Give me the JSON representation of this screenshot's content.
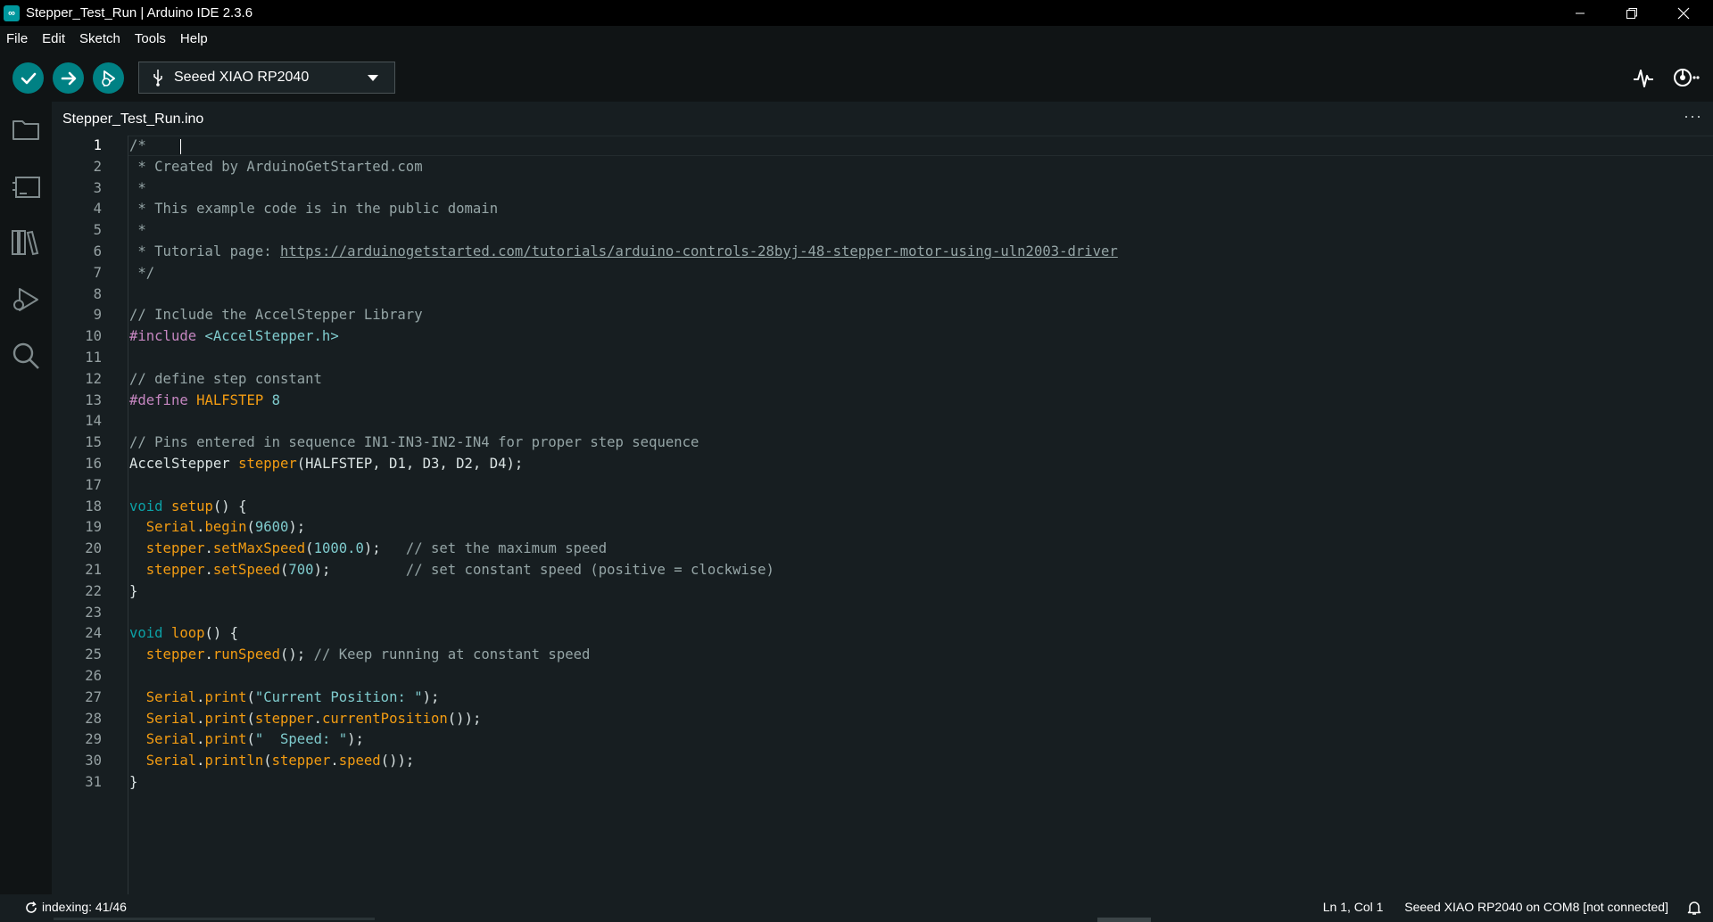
{
  "window": {
    "title": "Stepper_Test_Run | Arduino IDE 2.3.6",
    "logo_text": "∞"
  },
  "menu": [
    "File",
    "Edit",
    "Sketch",
    "Tools",
    "Help"
  ],
  "toolbar": {
    "board": "Seeed XIAO RP2040",
    "icons": [
      "verify-icon",
      "upload-icon",
      "debug-icon",
      "usb-icon",
      "chevron-down-icon",
      "serial-plotter-icon",
      "serial-monitor-icon"
    ]
  },
  "sidebar": {
    "icons": [
      "folder-icon",
      "boards-manager-icon",
      "library-manager-icon",
      "debug-icon",
      "search-icon"
    ]
  },
  "tab": {
    "label": "Stepper_Test_Run.ino",
    "more": "···"
  },
  "code": {
    "line_numbers": [
      "1",
      "2",
      "3",
      "4",
      "5",
      "6",
      "7",
      "8",
      "9",
      "10",
      "11",
      "12",
      "13",
      "14",
      "15",
      "16",
      "17",
      "18",
      "19",
      "20",
      "21",
      "22",
      "23",
      "24",
      "25",
      "26",
      "27",
      "28",
      "29",
      "30",
      "31"
    ],
    "l1": "/*",
    "l2": " * Created by ArduinoGetStarted.com",
    "l3": " *",
    "l4": " * This example code is in the public domain",
    "l5": " *",
    "l6_pre": " * Tutorial page: ",
    "l6_link": "https://arduinogetstarted.com/tutorials/arduino-controls-28byj-48-stepper-motor-using-uln2003-driver",
    "l7": " */",
    "l9": "// Include the AccelStepper Library",
    "l10_pp": "#include",
    "l10_inc": "<AccelStepper.h>",
    "l12": "// define step constant",
    "l13_pp": "#define",
    "l13_mac": "HALFSTEP",
    "l13_num": "8",
    "l15": "// Pins entered in sequence IN1-IN3-IN2-IN4 for proper step sequence",
    "l16_type": "AccelStepper",
    "l16_fn": "stepper",
    "l16_rest": "(HALFSTEP, D1, D3, D2, D4);",
    "l18_kw": "void",
    "l18_fn": "setup",
    "l18_rest": "() {",
    "l19_obj": "Serial",
    "l19_fn": "begin",
    "l19_num": "9600",
    "l20_obj": "stepper",
    "l20_fn": "setMaxSpeed",
    "l20_num": "1000.0",
    "l20_c": "// set the maximum speed",
    "l21_obj": "stepper",
    "l21_fn": "setSpeed",
    "l21_num": "700",
    "l21_c": "// set constant speed (positive = clockwise)",
    "l22": "}",
    "l24_kw": "void",
    "l24_fn": "loop",
    "l24_rest": "() {",
    "l25_obj": "stepper",
    "l25_fn": "runSpeed",
    "l25_c": "// Keep running at constant speed",
    "l27_obj": "Serial",
    "l27_fn": "print",
    "l27_str": "\"Current Position: \"",
    "l28_obj": "Serial",
    "l28_fn": "print",
    "l28_obj2": "stepper",
    "l28_fn2": "currentPosition",
    "l29_obj": "Serial",
    "l29_fn": "print",
    "l29_str": "\"  Speed: \"",
    "l30_obj": "Serial",
    "l30_fn": "println",
    "l30_obj2": "stepper",
    "l30_fn2": "speed",
    "l31": "}"
  },
  "status": {
    "indexing": "indexing: 41/46",
    "position": "Ln 1, Col 1",
    "board": "Seeed XIAO RP2040 on COM8 [not connected]"
  },
  "colors": {
    "accent": "#008184",
    "editor_bg": "#171e21",
    "comment": "#95a5a6",
    "keyword": "#0ca1a6",
    "function": "#f39c12",
    "preprocessor": "#c586c0"
  }
}
